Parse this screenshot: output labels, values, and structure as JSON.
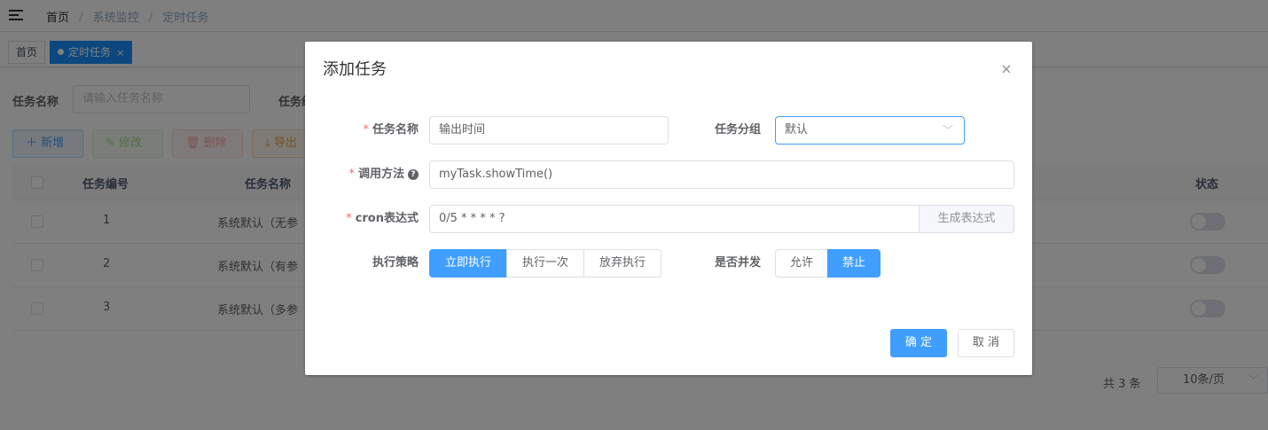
{
  "breadcrumb": [
    "首页",
    "系统监控",
    "定时任务"
  ],
  "tags": {
    "home": "首页",
    "current": "定时任务",
    "close_glyph": "×"
  },
  "search": {
    "name_label": "任务名称",
    "name_placeholder": "请输入任务名称",
    "group_label": "任务组"
  },
  "toolbar": {
    "add": "新增",
    "edit": "修改",
    "delete": "删除",
    "export": "导出"
  },
  "table": {
    "headers": {
      "id": "任务编号",
      "name": "任务名称",
      "status": "状态"
    },
    "rows": [
      {
        "id": "1",
        "name": "系统默认（无参"
      },
      {
        "id": "2",
        "name": "系统默认（有参"
      },
      {
        "id": "3",
        "name": "系统默认（多参"
      }
    ]
  },
  "pagination": {
    "total": "共 3 条",
    "page_size": "10条/页"
  },
  "dialog": {
    "title": "添加任务",
    "close_glyph": "×",
    "fields": {
      "job_name": {
        "label": "任务名称",
        "value": "输出时间"
      },
      "job_group": {
        "label": "任务分组",
        "value": "默认"
      },
      "invoke_target": {
        "label": "调用方法",
        "value": "myTask.showTime()"
      },
      "cron": {
        "label": "cron表达式",
        "value": "0/5 * * * * ?",
        "append": "生成表达式"
      },
      "misfire": {
        "label": "执行策略",
        "options": [
          "立即执行",
          "执行一次",
          "放弃执行"
        ],
        "selected": "立即执行"
      },
      "concurrent": {
        "label": "是否并发",
        "options": [
          "允许",
          "禁止"
        ],
        "selected": "禁止"
      }
    },
    "buttons": {
      "confirm": "确 定",
      "cancel": "取 消"
    }
  },
  "colors": {
    "primary": "#409eff",
    "required": "#f56c6c",
    "overlay": "rgba(0,0,0,0.5)"
  }
}
